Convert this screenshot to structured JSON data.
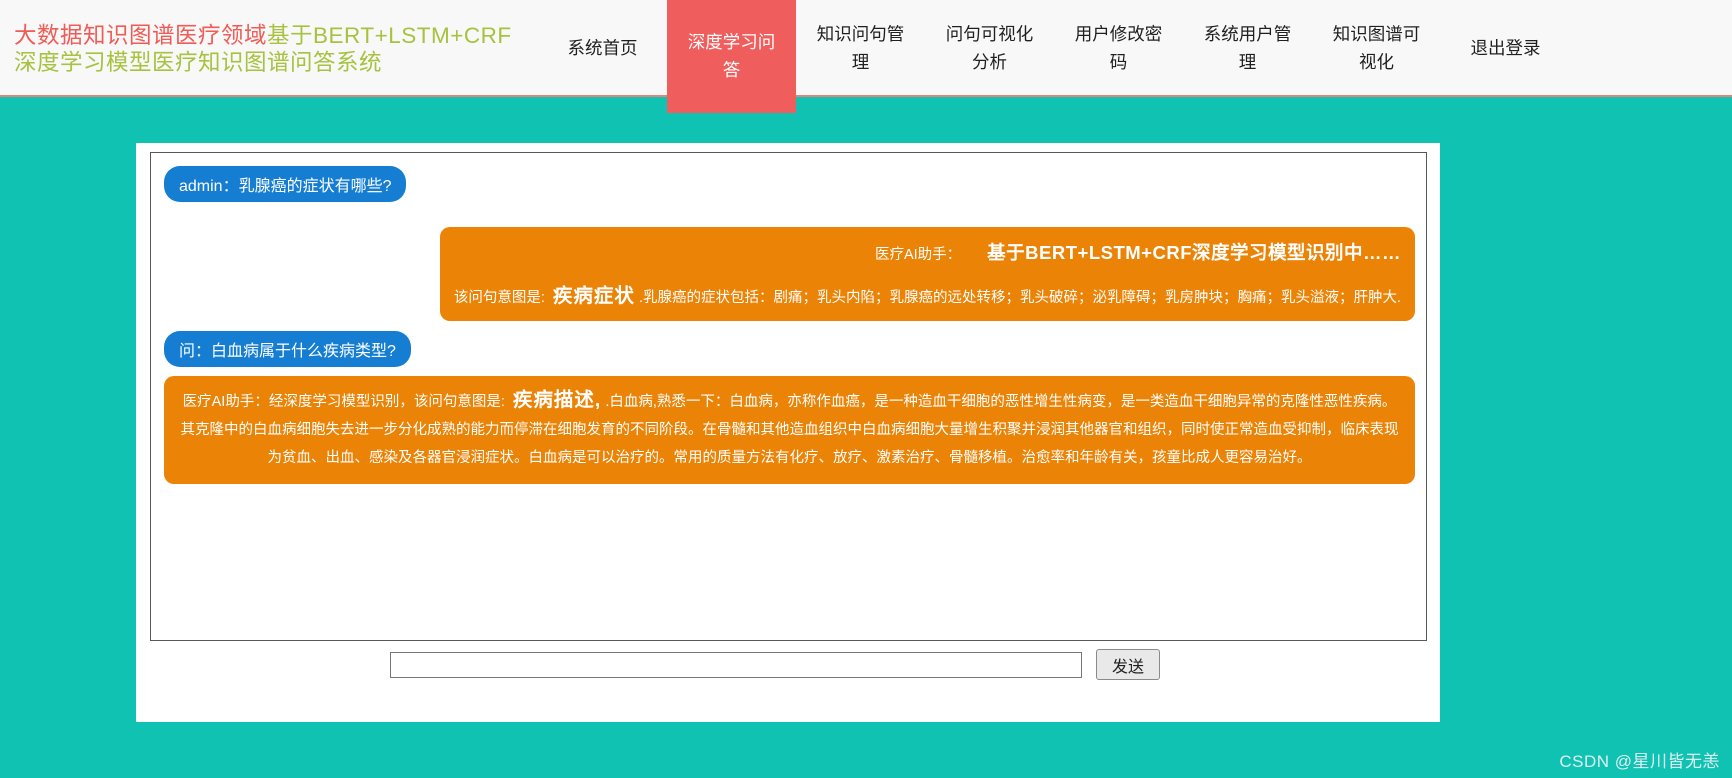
{
  "page": {
    "background_color": "#10c2b2",
    "watermark": "CSDN @星川皆无恙"
  },
  "header": {
    "logo_segment_red": "大数据知识图谱医疗领域",
    "logo_segment_green": "基于BERT+LSTM+CRF深度学习模型医疗知识图谱问答系统",
    "colors": {
      "header_bg": "#f8f8f8",
      "header_border": "#e8837a",
      "logo_red": "#ee5c55",
      "logo_green": "#a6c23f",
      "active_tab_bg": "#ef5d5d",
      "active_tab_text": "#ffffff",
      "nav_text": "#1f1f1f"
    },
    "nav": {
      "items": [
        {
          "label": "系统首页",
          "active": false
        },
        {
          "label": "深度学习问答",
          "active": true
        },
        {
          "label": "知识问句管理",
          "active": false
        },
        {
          "label": "问句可视化分析",
          "active": false
        },
        {
          "label": "用户修改密码",
          "active": false
        },
        {
          "label": "系统用户管理",
          "active": false
        },
        {
          "label": "知识图谱可视化",
          "active": false
        },
        {
          "label": "退出登录",
          "active": false
        }
      ]
    }
  },
  "chat": {
    "colors": {
      "user_bubble_bg": "#157ed2",
      "ai_bubble_bg": "#ea8306",
      "bubble_text": "#ffffff",
      "chatbox_border": "#58585a"
    },
    "message1_user": "admin：乳腺癌的症状有哪些?",
    "message2_ai": {
      "assistant_label": "医疗AI助手：",
      "status_text": "基于BERT+LSTM+CRF深度学习模型识别中……",
      "intent_prefix": "该问句意图是: ",
      "intent_label": "疾病症状",
      "answer_text": ".乳腺癌的症状包括：剧痛；乳头内陷；乳腺癌的远处转移；乳头破碎；泌乳障碍；乳房肿块；胸痛；乳头溢液；肝肿大."
    },
    "message3_user": "问：白血病属于什么疾病类型?",
    "message4_ai": {
      "intent_prefix": "医疗AI助手：经深度学习模型识别，该问句意图是: ",
      "intent_label": "疾病描述,",
      "answer_text": ".白血病,熟悉一下：白血病，亦称作血癌，是一种造血干细胞的恶性增生性病变，是一类造血干细胞异常的克隆性恶性疾病。其克隆中的白血病细胞失去进一步分化成熟的能力而停滞在细胞发育的不同阶段。在骨髓和其他造血组织中白血病细胞大量增生积聚并浸润其他器官和组织，同时使正常造血受抑制，临床表现为贫血、出血、感染及各器官浸润症状。白血病是可以治疗的。常用的质量方法有化疗、放疗、激素治疗、骨髓移植。治愈率和年龄有关，孩童比成人更容易治好。"
    }
  },
  "composer": {
    "input_value": "",
    "input_placeholder": "",
    "send_label": "发送"
  }
}
